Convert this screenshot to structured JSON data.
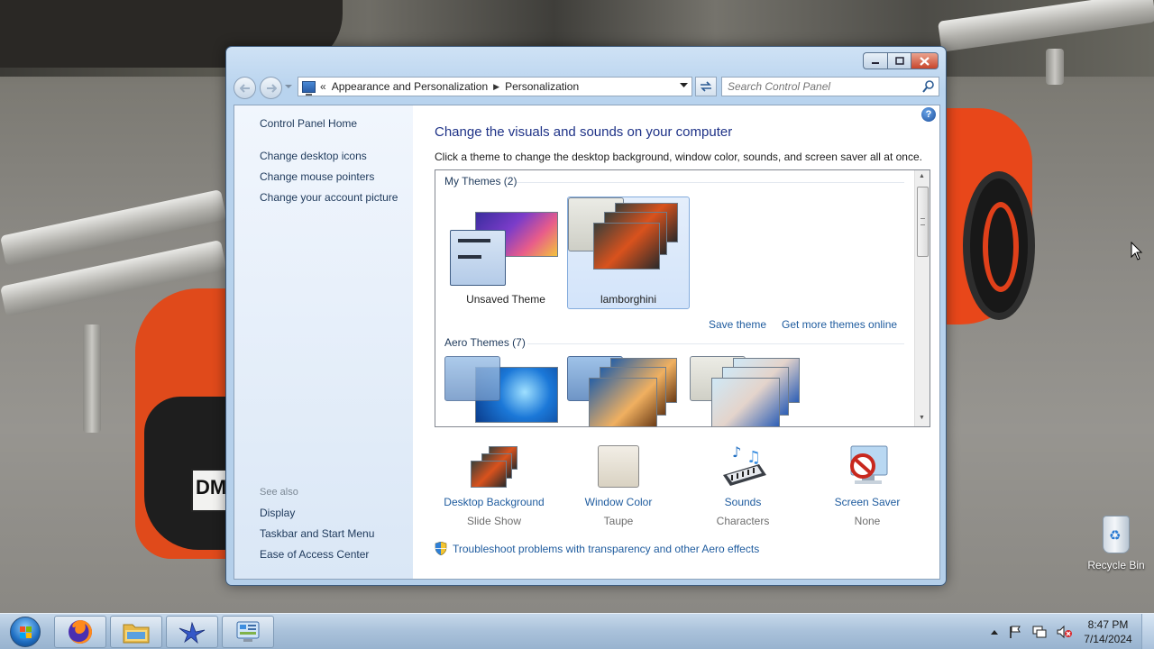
{
  "window": {
    "buttons": {
      "minimize": "minimize",
      "maximize": "maximize",
      "close": "close"
    }
  },
  "address_bar": {
    "overflow": "«",
    "crumbs": [
      "Appearance and Personalization",
      "Personalization"
    ]
  },
  "search": {
    "placeholder": "Search Control Panel",
    "value": ""
  },
  "left_pane": {
    "home": "Control Panel Home",
    "links": [
      "Change desktop icons",
      "Change mouse pointers",
      "Change your account picture"
    ],
    "see_also_heading": "See also",
    "see_also": [
      "Display",
      "Taskbar and Start Menu",
      "Ease of Access Center"
    ]
  },
  "main": {
    "help": "?",
    "title": "Change the visuals and sounds on your computer",
    "description": "Click a theme to change the desktop background, window color, sounds, and screen saver all at once.",
    "my_themes_heading": "My Themes (2)",
    "my_themes": [
      "Unsaved Theme",
      "lamborghini"
    ],
    "selected_theme": "lamborghini",
    "save_theme": "Save theme",
    "get_more": "Get more themes online",
    "aero_heading": "Aero Themes (7)",
    "options": [
      {
        "name": "Desktop Background",
        "value": "Slide Show",
        "icon": "desktop-background-icon"
      },
      {
        "name": "Window Color",
        "value": "Taupe",
        "icon": "window-color-icon"
      },
      {
        "name": "Sounds",
        "value": "Characters",
        "icon": "sounds-icon"
      },
      {
        "name": "Screen Saver",
        "value": "None",
        "icon": "screen-saver-icon"
      }
    ],
    "troubleshoot": "Troubleshoot problems with transparency and other Aero effects"
  },
  "desktop": {
    "recycle_bin": "Recycle Bin",
    "plate_text": "DM"
  },
  "taskbar": {
    "pinned": [
      "firefox-icon",
      "file-explorer-icon",
      "app-bird-icon",
      "control-panel-icon"
    ],
    "tray_icons": [
      "show-hidden-icons",
      "action-center-flag-icon",
      "network-icon",
      "volume-muted-icon"
    ],
    "time": "8:47 PM",
    "date": "7/14/2024"
  },
  "colors": {
    "link_blue": "#1e5b9e",
    "title_blue": "#1e3287",
    "window_chrome": "#b8d3ee",
    "taskbar": "#a9c1da",
    "window_color_taupe": "#e4ded0"
  }
}
